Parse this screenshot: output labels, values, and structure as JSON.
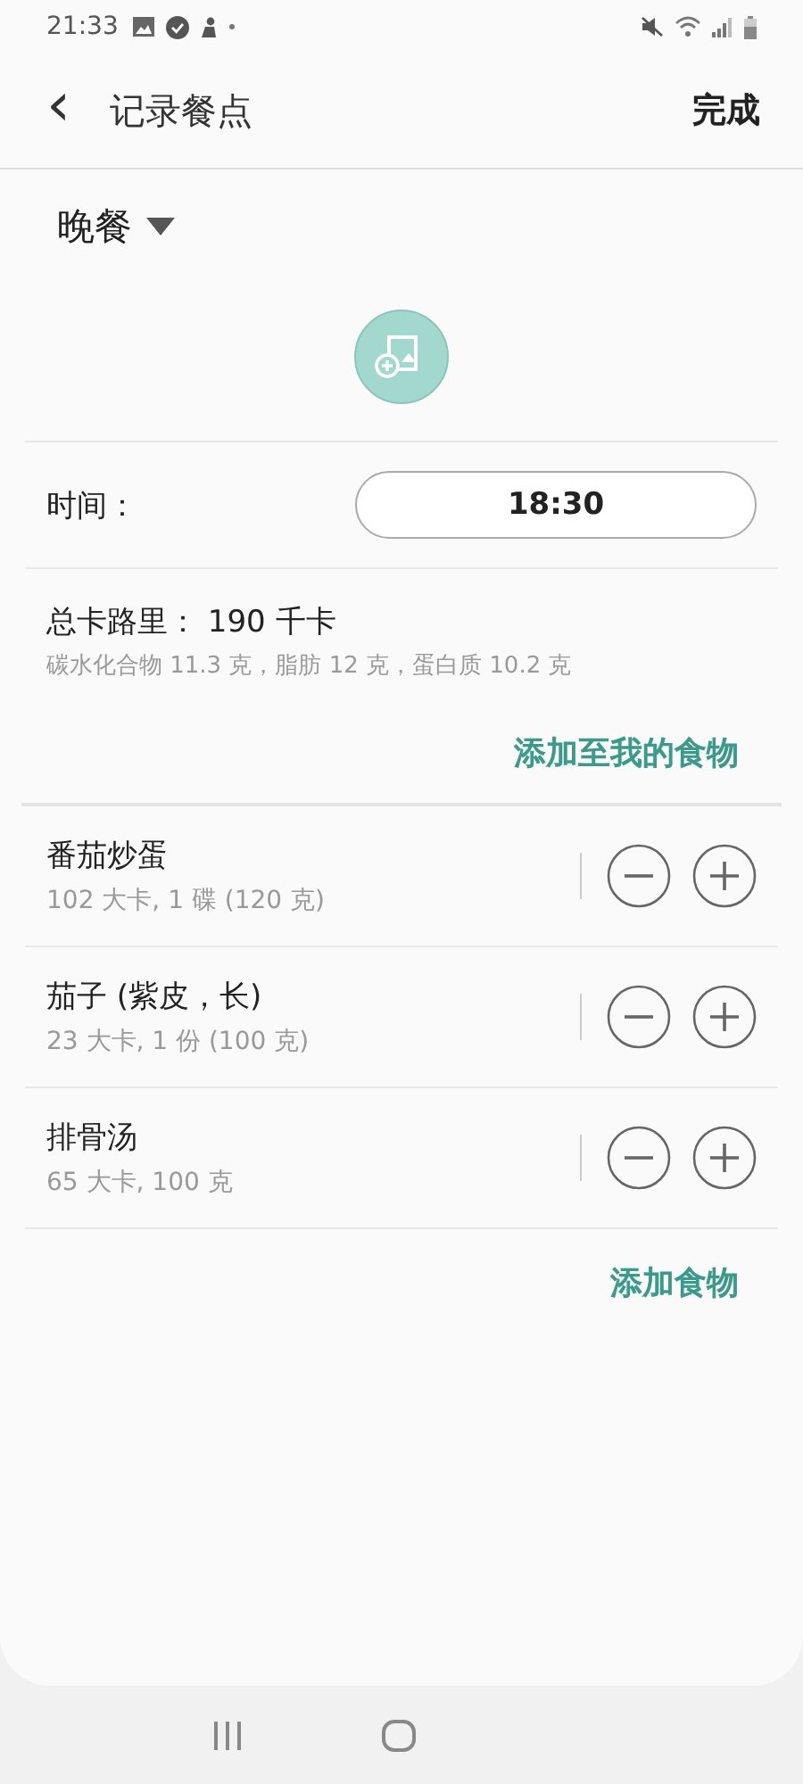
{
  "status_bar": {
    "time": "21:33"
  },
  "header": {
    "back": "‹",
    "title": "记录餐点",
    "done": "完成"
  },
  "meal": {
    "label": "晚餐"
  },
  "time_row": {
    "label": "时间：",
    "value": "18:30"
  },
  "summary": {
    "total": "总卡路里： 190 千卡",
    "breakdown": "碳水化合物 11.3 克，脂肪 12 克，蛋白质 10.2 克"
  },
  "add_to_my_food": "添加至我的食物",
  "foods": [
    {
      "name": "番茄炒蛋",
      "detail": "102 大卡, 1 碟 (120 克)"
    },
    {
      "name": "茄子 (紫皮，长)",
      "detail": "23 大卡, 1 份 (100 克)"
    },
    {
      "name": "排骨汤",
      "detail": "65 大卡, 100 克"
    }
  ],
  "add_food": "添加食物"
}
